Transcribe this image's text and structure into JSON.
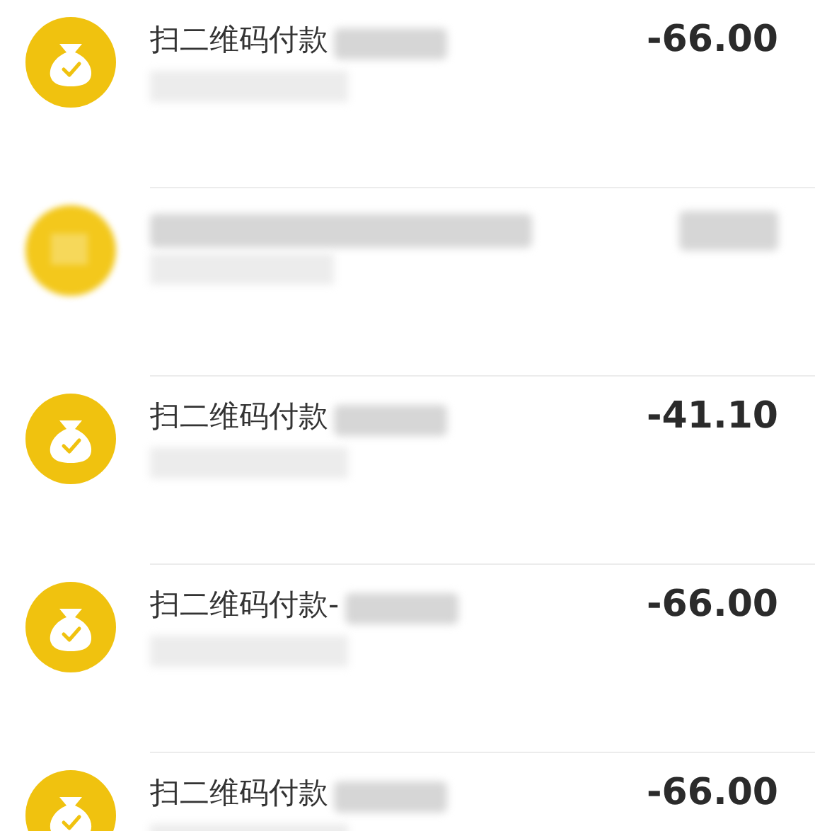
{
  "transactions": [
    {
      "kind": "payment",
      "title": "扫二维码付款",
      "amount": "-66.00"
    },
    {
      "kind": "redacted"
    },
    {
      "kind": "payment",
      "title": "扫二维码付款",
      "amount": "-41.10"
    },
    {
      "kind": "payment",
      "title": "扫二维码付款-",
      "amount": "-66.00"
    },
    {
      "kind": "payment",
      "title": "扫二维码付款",
      "amount": "-66.00"
    }
  ]
}
